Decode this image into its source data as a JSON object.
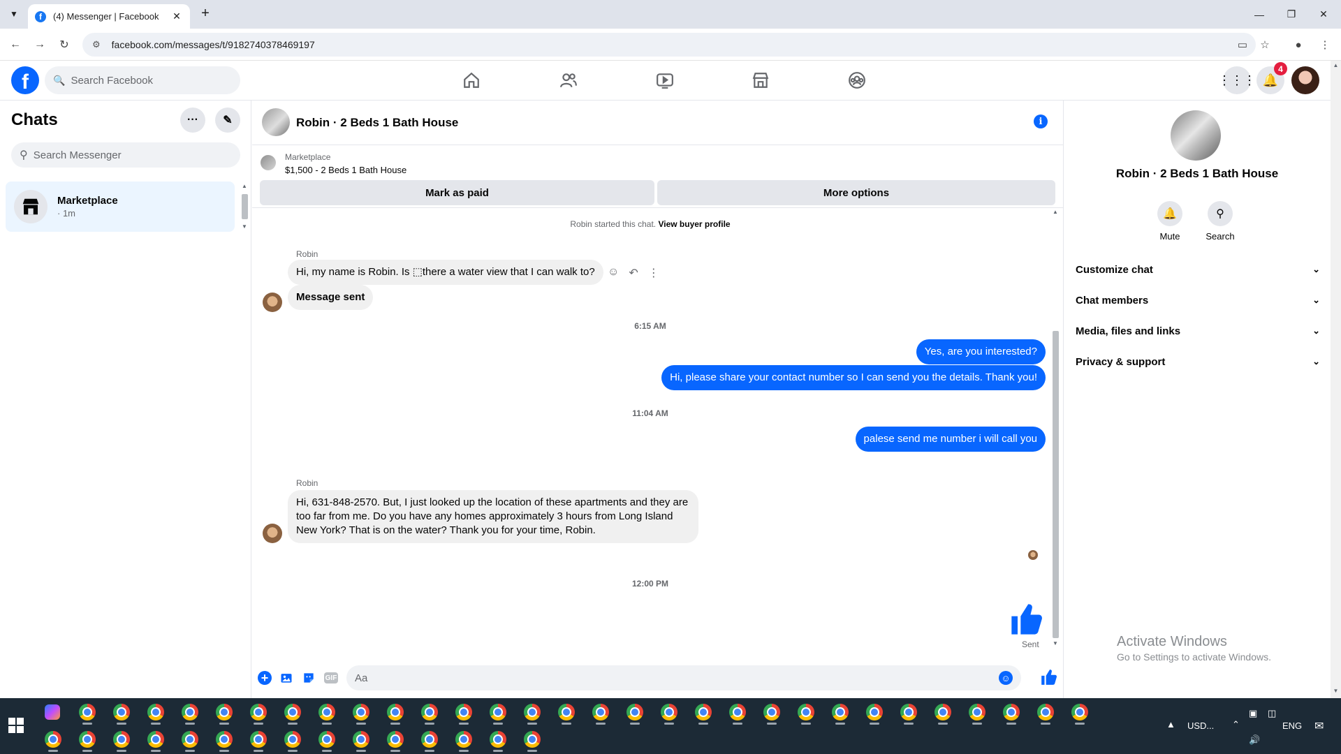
{
  "browser": {
    "tab_title": "(4) Messenger | Facebook",
    "url": "facebook.com/messages/t/9182740378469197"
  },
  "fb_header": {
    "search_placeholder": "Search Facebook",
    "notification_count": "4"
  },
  "chats": {
    "title": "Chats",
    "search_placeholder": "Search Messenger",
    "items": [
      {
        "name": "Marketplace",
        "sub": "· 1m"
      }
    ]
  },
  "conversation": {
    "title": "Robin · 2 Beds 1 Bath House",
    "marketplace_label": "Marketplace",
    "listing": "$1,500 - 2 Beds 1 Bath House",
    "mark_paid": "Mark as paid",
    "more_options": "More options",
    "started_text": "Robin started this chat.",
    "view_profile": "View buyer profile",
    "sender_1": "Robin",
    "msg_1": "Hi, my name is Robin. Is ⬚there a water view that I can walk to?",
    "msg_2": "Message sent",
    "time_1": "6:15 AM",
    "out_1": "Yes, are you interested?",
    "out_2": "Hi, please share your contact number so I can send you the details. Thank you!",
    "time_2": "11:04 AM",
    "out_3": "palese send me number i will call you",
    "sender_2": "Robin",
    "msg_3": "Hi, 631-848-2570. But, I just looked up the location of these apartments and they are too far from me. Do you have any homes approximately 3 hours from Long Island New York? That is on the water? Thank you for your time, Robin.",
    "time_3": "12:00 PM",
    "sent_label": "Sent",
    "composer_placeholder": "Aa"
  },
  "details": {
    "name": "Robin · 2 Beds 1 Bath House",
    "mute": "Mute",
    "search": "Search",
    "sections": [
      "Customize chat",
      "Chat members",
      "Media, files and links",
      "Privacy & support"
    ],
    "watermark_1": "Activate Windows",
    "watermark_2": "Go to Settings to activate Windows."
  },
  "taskbar": {
    "currency": "USD...",
    "lang": "ENG"
  },
  "colors": {
    "accent": "#0866ff",
    "selected_chat": "#ebf5ff",
    "badge": "#e41e3f"
  }
}
